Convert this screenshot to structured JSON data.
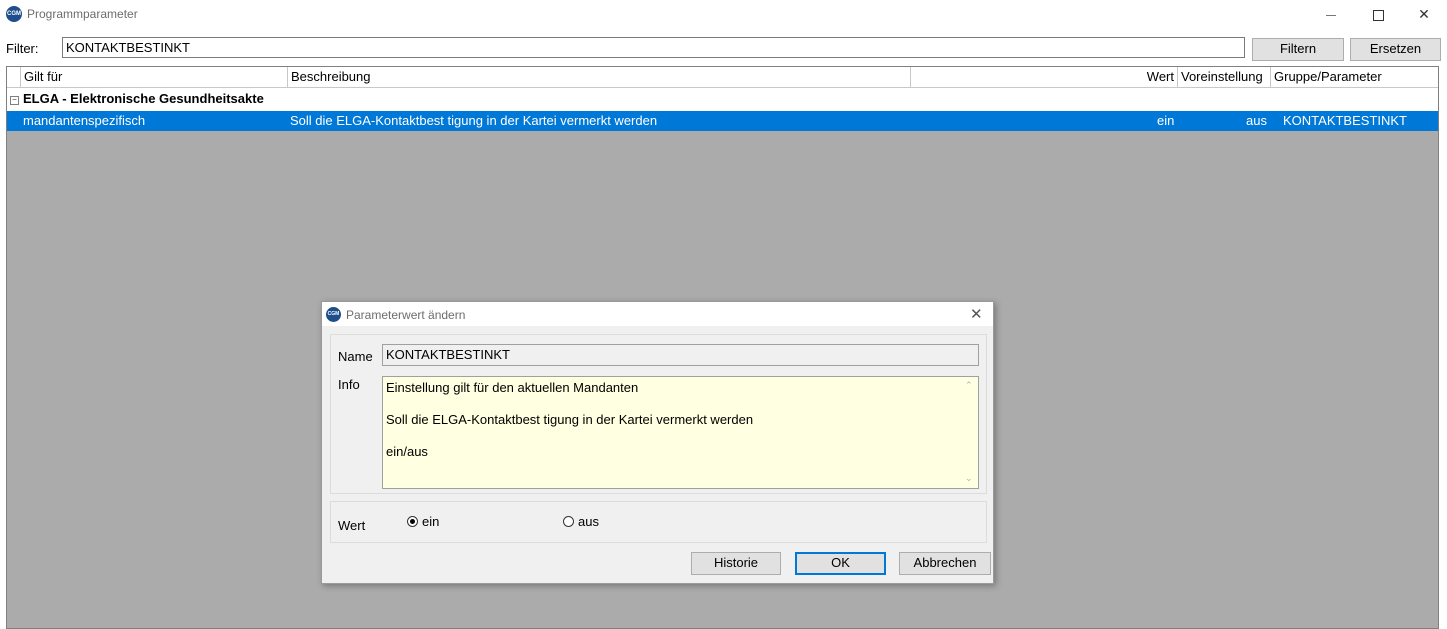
{
  "window": {
    "title": "Programmparameter",
    "app_icon": "CGM"
  },
  "filter": {
    "label": "Filter:",
    "value": "KONTAKTBESTINKT",
    "filter_button": "Filtern",
    "replace_button": "Ersetzen"
  },
  "grid": {
    "headers": [
      "Gilt für",
      "Beschreibung",
      "Wert",
      "Voreinstellung",
      "Gruppe/Parameter"
    ],
    "group": {
      "title": "ELGA - Elektronische Gesundheitsakte",
      "collapse_symbol": "⊟"
    },
    "row": {
      "gilt_fuer": "mandantenspezifisch",
      "beschreibung": "Soll die ELGA-Kontaktbest tigung in der Kartei vermerkt werden",
      "wert": "ein",
      "voreinstellung": "aus",
      "parameter": "KONTAKTBESTINKT"
    }
  },
  "dialog": {
    "title": "Parameterwert ändern",
    "name_label": "Name",
    "name_value": "KONTAKTBESTINKT",
    "info_label": "Info",
    "info_lines": [
      "Einstellung gilt für den aktuellen Mandanten",
      "Soll die ELGA-Kontaktbest tigung in der Kartei vermerkt werden",
      "ein/aus"
    ],
    "wert_label": "Wert",
    "option_ein": "ein",
    "option_aus": "aus",
    "selected": "ein",
    "button_historie": "Historie",
    "button_ok": "OK",
    "button_abbrechen": "Abbrechen"
  },
  "colors": {
    "selection": "#0078d7",
    "info_bg": "#ffffe1",
    "grid_bg": "#ababab"
  }
}
